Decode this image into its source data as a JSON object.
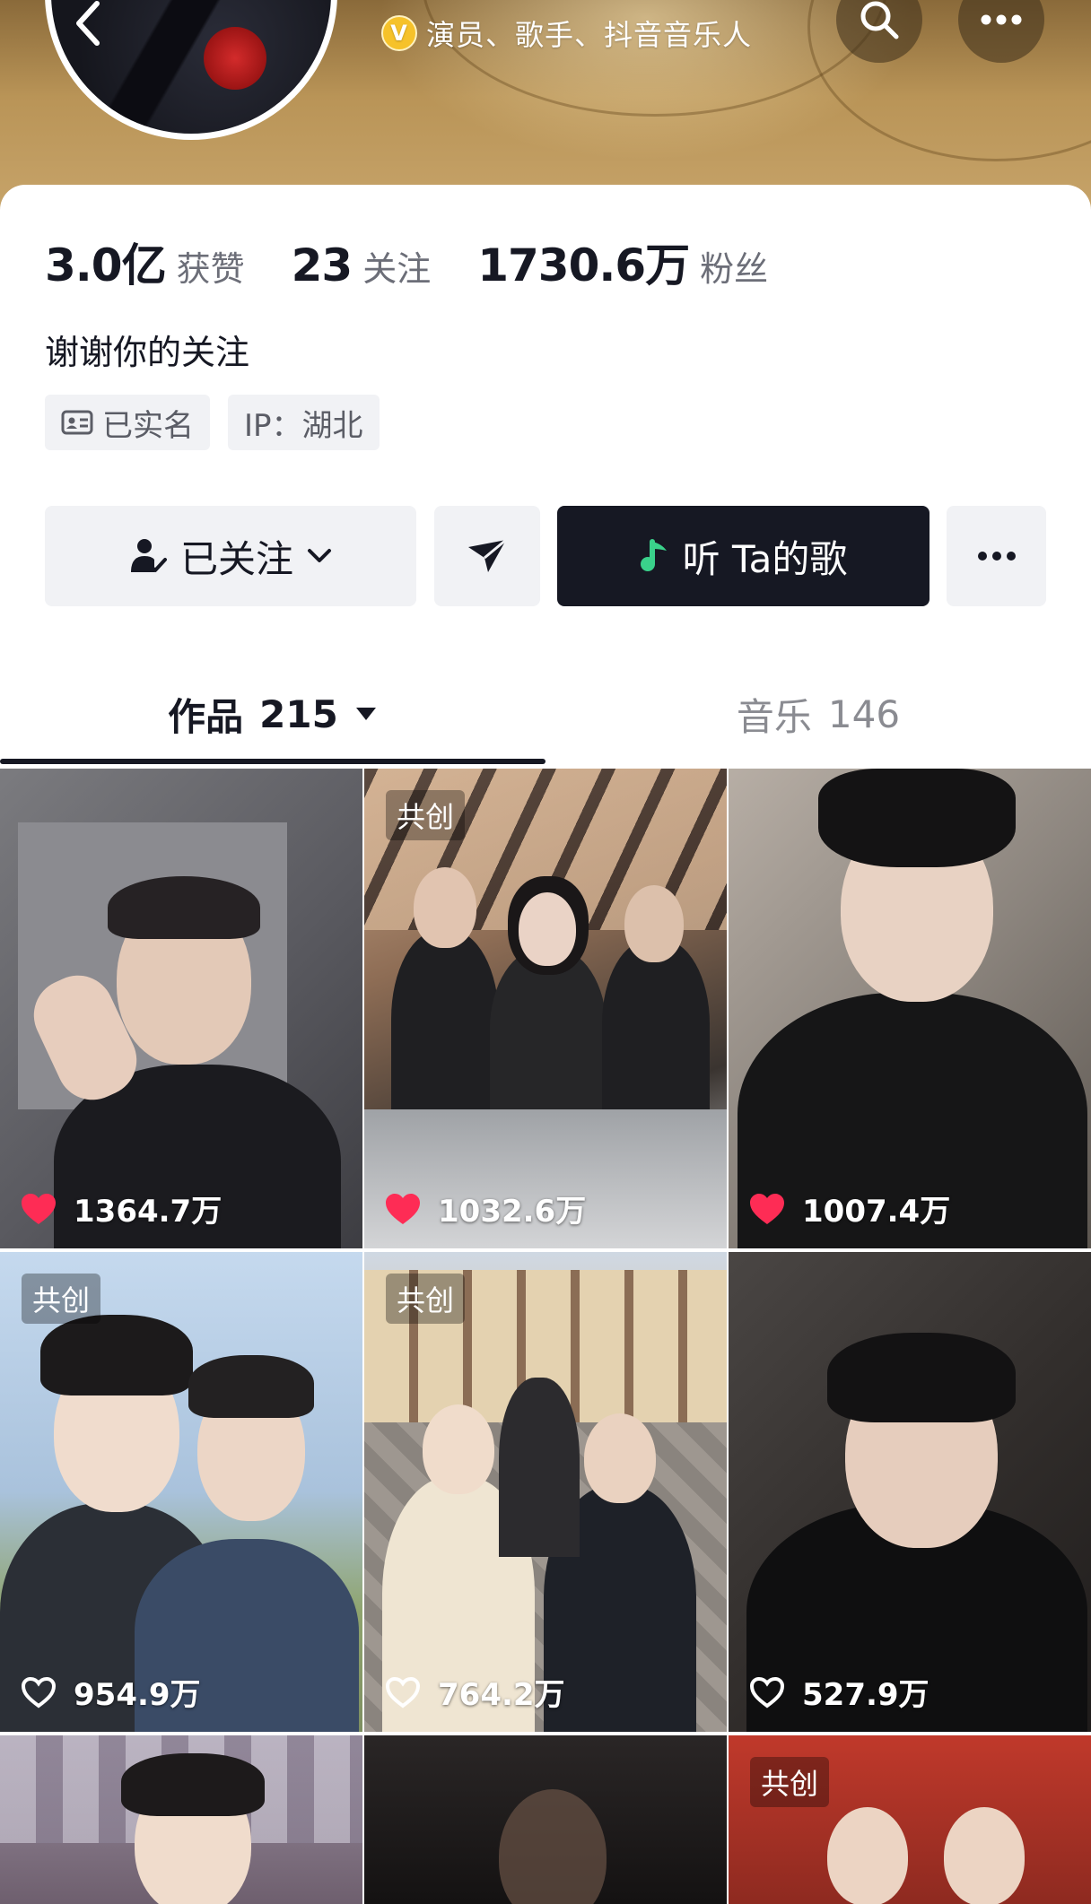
{
  "header": {
    "verify_badge": "V",
    "verify_text": "演员、歌手、抖音音乐人"
  },
  "stats": [
    {
      "value": "3.0亿",
      "label": "获赞"
    },
    {
      "value": "23",
      "label": "关注"
    },
    {
      "value": "1730.6万",
      "label": "粉丝"
    }
  ],
  "bio": "谢谢你的关注",
  "tags": {
    "verified": "已实名",
    "ip": "IP：湖北"
  },
  "actions": {
    "follow_label": "已关注",
    "music_label": "听 Ta的歌"
  },
  "tabs": {
    "works_label": "作品",
    "works_count": "215",
    "music_label": "音乐",
    "music_count": "146"
  },
  "grid": {
    "co_label": "共创",
    "items": [
      {
        "likes": "1364.7万",
        "liked": true,
        "co": false
      },
      {
        "likes": "1032.6万",
        "liked": true,
        "co": true
      },
      {
        "likes": "1007.4万",
        "liked": true,
        "co": false
      },
      {
        "likes": "954.9万",
        "liked": false,
        "co": true
      },
      {
        "likes": "764.2万",
        "liked": false,
        "co": true
      },
      {
        "likes": "527.9万",
        "liked": false,
        "co": false
      },
      {
        "likes": "",
        "liked": false,
        "co": false
      },
      {
        "likes": "",
        "liked": false,
        "co": false
      },
      {
        "likes": "",
        "liked": false,
        "co": true
      }
    ]
  },
  "colors": {
    "accent_dark": "#161823",
    "like_red": "#fe2c55",
    "verify_gold": "#f6c22a"
  }
}
